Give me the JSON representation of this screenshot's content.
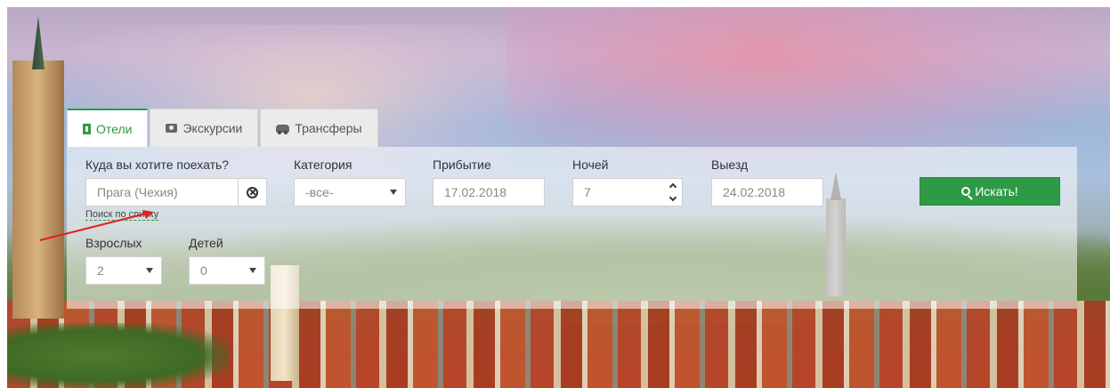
{
  "tabs": [
    {
      "label": "Отели",
      "icon": "hotel-icon",
      "active": true
    },
    {
      "label": "Экскурсии",
      "icon": "camera-icon",
      "active": false
    },
    {
      "label": "Трансферы",
      "icon": "car-icon",
      "active": false
    }
  ],
  "form": {
    "destination": {
      "label": "Куда вы хотите поехать?",
      "value": "Прага (Чехия)",
      "list_link": "Поиск по списку"
    },
    "category": {
      "label": "Категория",
      "value": "-все-"
    },
    "arrival": {
      "label": "Прибытие",
      "value": "17.02.2018"
    },
    "nights": {
      "label": "Ночей",
      "value": "7"
    },
    "departure": {
      "label": "Выезд",
      "value": "24.02.2018"
    },
    "adults": {
      "label": "Взрослых",
      "value": "2"
    },
    "children": {
      "label": "Детей",
      "value": "0"
    },
    "search_label": "Искать!"
  },
  "colors": {
    "accent": "#2e9a46",
    "annotation_arrow": "#e02020"
  }
}
